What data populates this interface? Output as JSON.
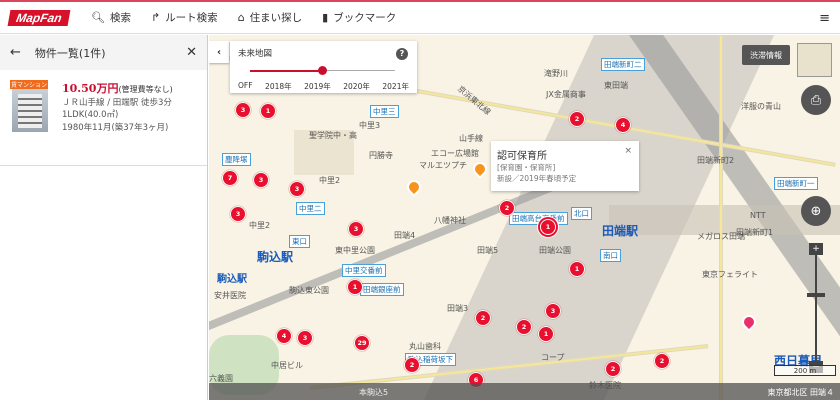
{
  "header": {
    "logo": "MapFan",
    "nav": [
      {
        "icon": "search-icon",
        "label": "検索"
      },
      {
        "icon": "route-icon",
        "label": "ルート検索"
      },
      {
        "icon": "house-search-icon",
        "label": "住まい探し"
      },
      {
        "icon": "bookmark-icon",
        "label": "ブックマーク"
      }
    ],
    "menu_icon": "hamburger-icon"
  },
  "sidebar": {
    "title": "物件一覧(1件)",
    "listing": {
      "tag": "賃マンション",
      "price": "10.50万円",
      "fee": "(管理費等なし)",
      "access": "ＪＲ山手線 / 田端駅 徒歩3分",
      "layout": "1LDK(40.0㎡)",
      "built": "1980年11月(築37年3ヶ月)"
    }
  },
  "future_map": {
    "title": "未来地図",
    "help": "?",
    "options": [
      "OFF",
      "2018年",
      "2019年",
      "2020年",
      "2021年"
    ],
    "selected": "2019年",
    "selected_index": 2
  },
  "popup": {
    "title": "認可保育所",
    "category": "[保育園・保育所]",
    "note": "新設／2019年春頃予定",
    "close": "×"
  },
  "map": {
    "traffic_label": "渋滞情報",
    "scale": "200 m",
    "address": "東京都北区 田端４",
    "stations": [
      "駒込駅",
      "田端駅",
      "西日暮里",
      "駒込駅"
    ],
    "signs": [
      "中里三",
      "中里二",
      "中里交番前",
      "田端銀座前",
      "駒込稲荷坂下",
      "田端高台交番前",
      "田端新町二",
      "田端新町一",
      "塵降塚",
      "北口",
      "南口",
      "東口"
    ],
    "labels": [
      "聖学院中・高",
      "中里3",
      "中里2",
      "円勝寺",
      "エコー広場館",
      "マルエツプチ",
      "山手線",
      "京浜東北線",
      "八幡神社",
      "田端4",
      "田端5",
      "田端3",
      "東中里公園",
      "駒込東公園",
      "丸山歯科",
      "田端公園",
      "コープ",
      "鈴木医院",
      "東田端",
      "滝野川",
      "JX金属商事",
      "田端新町2",
      "田端新町1",
      "NTT",
      "東京フェライト",
      "メガロス田端",
      "洋服の青山",
      "中里2",
      "六義園",
      "安井医院",
      "中居ビル",
      "本駒込5"
    ],
    "markers": [
      "3",
      "1",
      "2",
      "4",
      "7",
      "3",
      "3",
      "3",
      "3",
      "1",
      "2",
      "1",
      "1",
      "3",
      "2",
      "2",
      "1",
      "4",
      "3",
      "29",
      "2",
      "6",
      "2",
      "2",
      "2"
    ]
  }
}
